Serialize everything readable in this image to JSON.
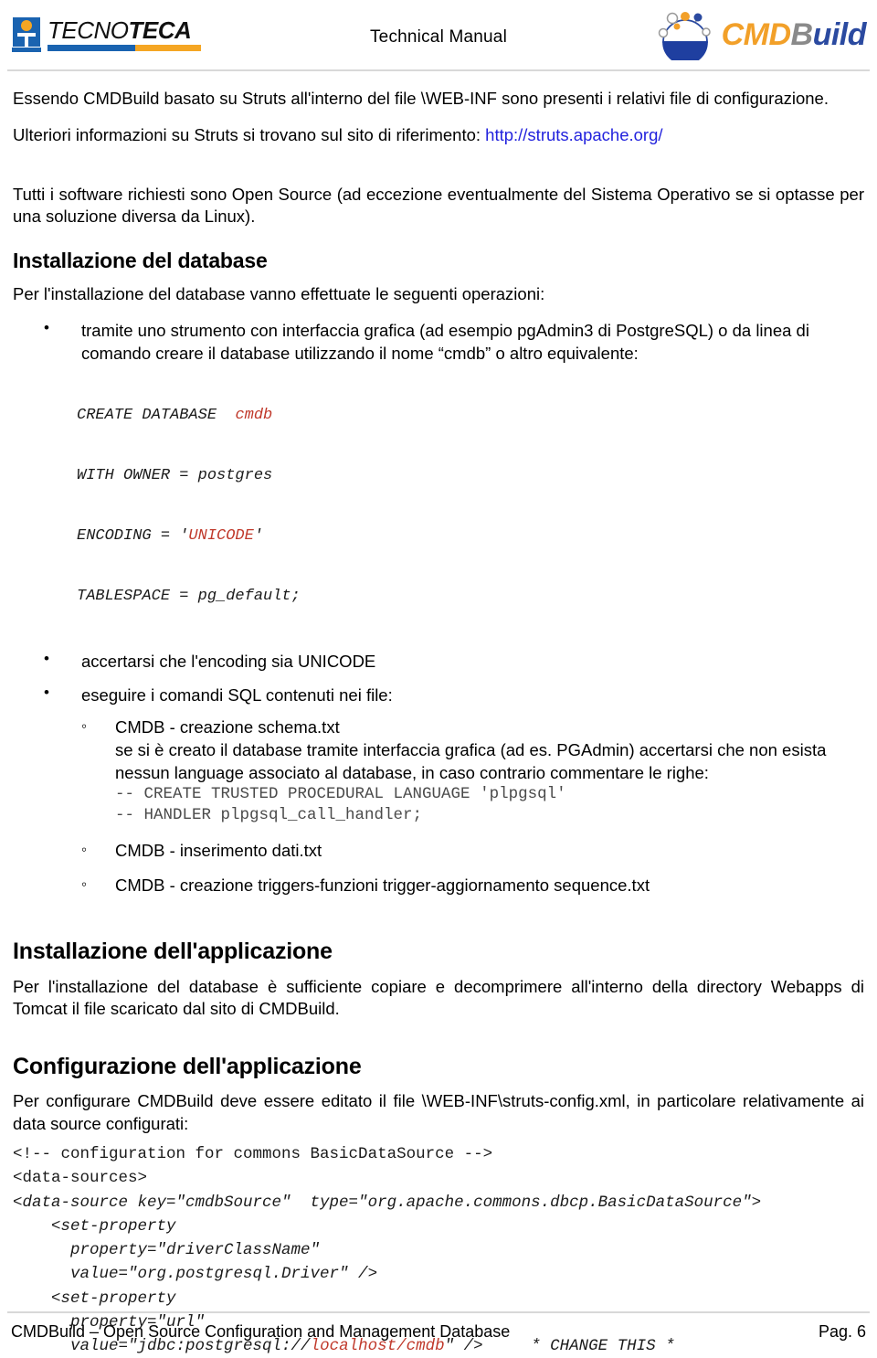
{
  "header": {
    "title": "Technical Manual",
    "left_logo": {
      "name": "TECNOTECA",
      "name_part1": "TECNO",
      "name_part2": "TECA"
    },
    "right_logo": {
      "name": "CMDBuild",
      "part_cmd": "CMD",
      "part_b": "B",
      "part_uild": "uild"
    }
  },
  "content": {
    "para1": "Essendo CMDBuild basato su Struts all'interno del file \\WEB-INF sono presenti i relativi file di configurazione.",
    "para2_prefix": "Ulteriori informazioni su Struts si trovano sul sito di riferimento: ",
    "para2_link": "http://struts.apache.org/",
    "para3": "Tutti i software richiesti sono Open Source (ad eccezione eventualmente del Sistema Operativo se si optasse per una soluzione diversa da Linux).",
    "heading_db": "Installazione del database",
    "para_db_intro": "Per l'installazione del database vanno effettuate le seguenti operazioni:",
    "bullet1": "tramite uno strumento con interfaccia grafica (ad esempio pgAdmin3 di PostgreSQL) o da linea di comando creare il database utilizzando il nome “cmdb” o altro equivalente:",
    "sql": {
      "line1_pre": "CREATE DATABASE  ",
      "line1_red": "cmdb",
      "line2": "WITH OWNER = postgres",
      "line3_pre": "ENCODING = '",
      "line3_red": "UNICODE",
      "line3_post": "'",
      "line4": "TABLESPACE = pg_default;"
    },
    "bullet2": "accertarsi che l'encoding sia UNICODE",
    "bullet3": "eseguire i comandi SQL contenuti nei file:",
    "sub1_title": "CMDB - creazione schema.txt",
    "sub1_text": "se si è creato il database tramite interfaccia grafica (ad es. PGAdmin) accertarsi che non esista nessun language associato al database, in caso contrario commentare le righe:",
    "sub1_code_line1": "-- CREATE TRUSTED PROCEDURAL LANGUAGE 'plpgsql'",
    "sub1_code_line2": "-- HANDLER plpgsql_call_handler;",
    "sub2_title": "CMDB - inserimento dati.txt",
    "sub3_title": "CMDB - creazione triggers-funzioni trigger-aggiornamento sequence.txt",
    "heading_app": "Installazione dell'applicazione",
    "para_app": "Per l'installazione del database è sufficiente copiare e decomprimere all'interno della directory Webapps di Tomcat il file scaricato dal sito di CMDBuild.",
    "heading_conf": "Configurazione dell'applicazione",
    "para_conf": "Per configurare CMDBuild deve essere editato il file \\WEB-INF\\struts-config.xml, in particolare relativamente ai data source configurati:",
    "xml": {
      "line1": "<!-- configuration for commons BasicDataSource -->",
      "line2": "<data-sources>",
      "line3": "<data-source key=\"cmdbSource\"  type=\"org.apache.commons.dbcp.BasicDataSource\">",
      "line4": "    <set-property",
      "line5": "      property=\"driverClassName\"",
      "line6": "      value=\"org.postgresql.Driver\" />",
      "line7": "    <set-property",
      "line8": "      property=\"url\"",
      "line9_pre": "      value=\"jdbc:postgresql://",
      "line9_red": "localhost/cmdb",
      "line9_post": "\" />     * CHANGE THIS *"
    }
  },
  "footer": {
    "left": "CMDBuild – Open Source Configuration and Management Database",
    "right": "Pag. 6"
  },
  "colors": {
    "link": "#2222dd",
    "code_red": "#c0392b",
    "brand_blue": "#1a63b0",
    "brand_orange": "#f5a623",
    "cmd_orange": "#f2a029",
    "cmd_gray": "#8a8a8a",
    "cmd_blue": "#2b4aa0"
  }
}
